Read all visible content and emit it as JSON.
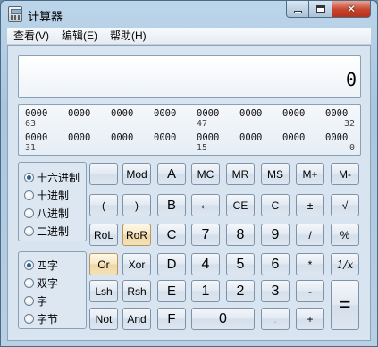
{
  "window": {
    "title": "计算器"
  },
  "menu": [
    {
      "label": "查看(V)"
    },
    {
      "label": "编辑(E)"
    },
    {
      "label": "帮助(H)"
    }
  ],
  "display": {
    "value": "0"
  },
  "bits": {
    "row1": {
      "groups": [
        "0000",
        "0000",
        "0000",
        "0000",
        "0000",
        "0000",
        "0000",
        "0000"
      ],
      "index_left": "63",
      "index_mid": "47",
      "index_right": "32"
    },
    "row2": {
      "groups": [
        "0000",
        "0000",
        "0000",
        "0000",
        "0000",
        "0000",
        "0000",
        "0000"
      ],
      "index_left": "31",
      "index_mid": "15",
      "index_right": "0"
    }
  },
  "base_options": [
    {
      "label": "十六进制",
      "selected": true
    },
    {
      "label": "十进制",
      "selected": false
    },
    {
      "label": "八进制",
      "selected": false
    },
    {
      "label": "二进制",
      "selected": false
    }
  ],
  "word_options": [
    {
      "label": "四字",
      "selected": true
    },
    {
      "label": "双字",
      "selected": false
    },
    {
      "label": "字",
      "selected": false
    },
    {
      "label": "字节",
      "selected": false
    }
  ],
  "keys": {
    "blank": "",
    "mod": "Mod",
    "A": "A",
    "MC": "MC",
    "MR": "MR",
    "MS": "MS",
    "Mplus": "M+",
    "Mminus": "M-",
    "lparen": "(",
    "rparen": ")",
    "B": "B",
    "back": "←",
    "CE": "CE",
    "C": "C",
    "pm": "±",
    "sqrt": "√",
    "RoL": "RoL",
    "RoR": "RoR",
    "Ckey": "C",
    "n7": "7",
    "n8": "8",
    "n9": "9",
    "div": "/",
    "pct": "%",
    "Or": "Or",
    "Xor": "Xor",
    "D": "D",
    "n4": "4",
    "n5": "5",
    "n6": "6",
    "mul": "*",
    "recip": "1/x",
    "Lsh": "Lsh",
    "Rsh": "Rsh",
    "E": "E",
    "n1": "1",
    "n2": "2",
    "n3": "3",
    "sub": "-",
    "eq": "=",
    "Not": "Not",
    "And": "And",
    "F": "F",
    "n0": "0",
    "dot": ".",
    "add": "+"
  }
}
